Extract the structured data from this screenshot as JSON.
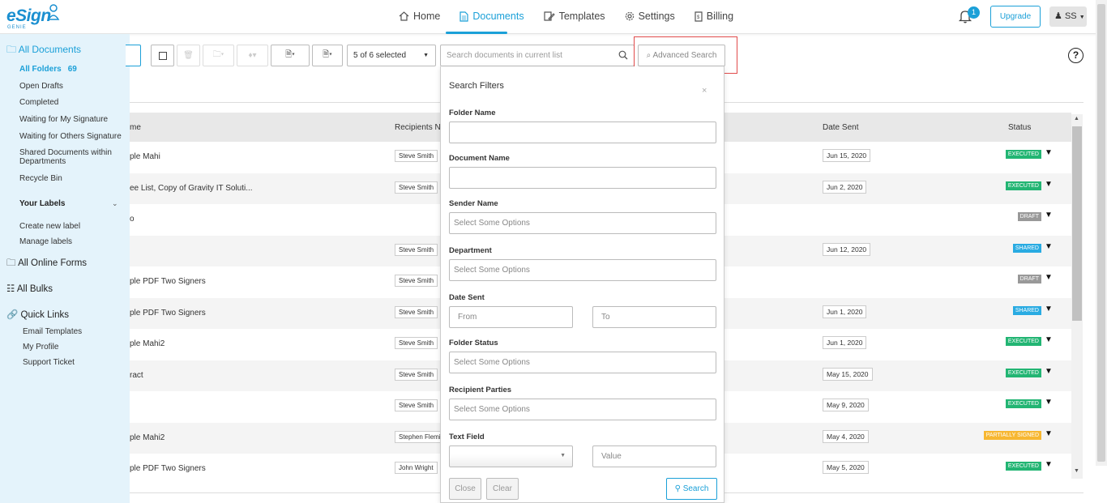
{
  "brand": {
    "logo_text": "eSign",
    "logo_sub": "GENIE"
  },
  "nav": {
    "home": "Home",
    "documents": "Documents",
    "templates": "Templates",
    "settings": "Settings",
    "billing": "Billing"
  },
  "header": {
    "notifications": "1",
    "upgrade": "Upgrade",
    "user": "SS"
  },
  "sidebar": {
    "all_documents": "All Documents",
    "all_folders": "All Folders",
    "all_folders_count": "69",
    "items": [
      "Open Drafts",
      "Completed",
      "Waiting for My Signature",
      "Waiting for Others Signature",
      "Shared Documents within Departments",
      "Recycle Bin"
    ],
    "labels_head": "Your Labels",
    "label_items": [
      "Create new label",
      "Manage labels"
    ],
    "online_forms": "All Online Forms",
    "bulks": "All Bulks",
    "quick_links": "Quick Links",
    "quick_items": [
      "Email Templates",
      "My Profile",
      "Support Ticket"
    ]
  },
  "toolbar": {
    "selection": "5 of 6 selected",
    "search_placeholder": "Search documents in current list",
    "advanced_search": "Advanced Search"
  },
  "table": {
    "col_name": "me",
    "col_recipients": "Recipients Na",
    "col_date": "Date Sent",
    "col_status": "Status",
    "rows": [
      {
        "name": "ple Mahi",
        "recipient": "Steve Smith",
        "date": "Jun 15, 2020",
        "status": "EXECUTED"
      },
      {
        "name": "ee List, Copy of Gravity IT Soluti...",
        "recipient": "Steve Smith",
        "date": "Jun 2, 2020",
        "status": "EXECUTED"
      },
      {
        "name": "o",
        "recipient": "",
        "date": "",
        "status": "DRAFT"
      },
      {
        "name": "",
        "recipient": "Steve Smith",
        "date": "Jun 12, 2020",
        "status": "SHARED"
      },
      {
        "name": "ple PDF Two Signers",
        "recipient": "Steve Smith",
        "date": "",
        "status": "DRAFT"
      },
      {
        "name": "ple PDF Two Signers",
        "recipient": "Steve Smith",
        "date": "Jun 1, 2020",
        "status": "SHARED"
      },
      {
        "name": "ple Mahi2",
        "recipient": "Steve Smith",
        "date": "Jun 1, 2020",
        "status": "EXECUTED"
      },
      {
        "name": "ract",
        "recipient": "Steve Smith",
        "date": "May 15, 2020",
        "status": "EXECUTED"
      },
      {
        "name": "",
        "recipient": "Steve Smith",
        "date": "May 9, 2020",
        "status": "EXECUTED"
      },
      {
        "name": "ple Mahi2",
        "recipient": "Stephen Flemi",
        "date": "May 4, 2020",
        "status": "PARTIALLY SIGNED"
      },
      {
        "name": "ple PDF Two Signers",
        "recipient": "John Wright",
        "date": "May 5, 2020",
        "status": "EXECUTED"
      }
    ]
  },
  "filters": {
    "title": "Search Filters",
    "close": "×",
    "folder_name": "Folder Name",
    "document_name": "Document Name",
    "sender_name": "Sender Name",
    "sender_placeholder": "Select Some Options",
    "department": "Department",
    "department_placeholder": "Select Some Options",
    "date_sent": "Date Sent",
    "from": "From",
    "to": "To",
    "folder_status": "Folder Status",
    "folder_status_placeholder": "Select Some Options",
    "recipient_parties": "Recipient Parties",
    "recipient_placeholder": "Select Some Options",
    "text_field": "Text Field",
    "value": "Value",
    "btn_close": "Close",
    "btn_clear": "Clear",
    "btn_search": "Search"
  },
  "colors": {
    "accent": "#1ba0d8",
    "executed": "#22b573",
    "draft": "#999999",
    "shared": "#29abe2",
    "partial": "#f7b731",
    "highlight": "#e14b4b"
  }
}
